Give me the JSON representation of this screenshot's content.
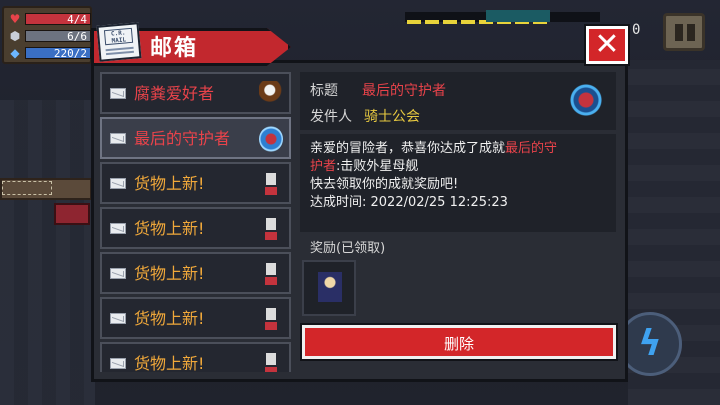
{
  "hud": {
    "hp": "4/4",
    "armor": "6/6",
    "energy": "220/2",
    "hp_icon": "heart-icon",
    "armor_icon": "shield-icon",
    "energy_icon": "crystal-icon",
    "coins": "0",
    "pause_icon": "pause-icon",
    "skill_icon": "lightning-icon"
  },
  "mailbox": {
    "title": "邮箱",
    "close_label": "✕",
    "mail_icon_text": "C.R.\nMAIL",
    "items": [
      {
        "label": "腐粪爱好者",
        "color": "red",
        "icon": "eagle-icon"
      },
      {
        "label": "最后的守护者",
        "color": "red",
        "icon": "orb-icon"
      },
      {
        "label": "货物上新!",
        "color": "orange",
        "icon": "vendor-icon"
      },
      {
        "label": "货物上新!",
        "color": "orange",
        "icon": "vendor-icon"
      },
      {
        "label": "货物上新!",
        "color": "orange",
        "icon": "vendor-icon"
      },
      {
        "label": "货物上新!",
        "color": "orange",
        "icon": "vendor-icon"
      },
      {
        "label": "货物上新!",
        "color": "orange",
        "icon": "vendor-icon"
      }
    ],
    "selected_index": 1
  },
  "detail": {
    "title_label": "标题",
    "title_value": "最后的守护者",
    "sender_label": "发件人",
    "sender_value": "骑士公会",
    "body_line1_pre": "亲爱的冒险者，恭喜你达成了成就",
    "body_line1_hl": "最后的守",
    "body_line2_hl": "护者",
    "body_line2_post": ":击败外星母舰",
    "body_line3": "快去领取你的成就奖励吧!",
    "body_line4": "达成时间: 2022/02/25 12:25:23",
    "reward_label": "奖励(已领取)",
    "delete_label": "删除"
  }
}
